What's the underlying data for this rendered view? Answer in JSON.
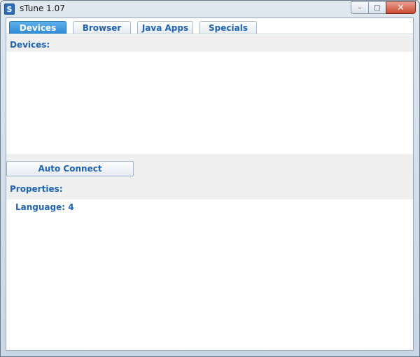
{
  "window": {
    "icon_letter": "S",
    "title": "sTune 1.07",
    "minimize": "–",
    "maximize": "□",
    "close": "✕"
  },
  "tabs": [
    {
      "label": "Devices",
      "active": true
    },
    {
      "label": "Browser",
      "active": false
    },
    {
      "label": "Java Apps",
      "active": false
    },
    {
      "label": "Specials",
      "active": false
    }
  ],
  "devices": {
    "header": "Devices:"
  },
  "actions": {
    "auto_connect": "Auto Connect"
  },
  "properties": {
    "header": "Properties:",
    "rows": [
      {
        "text": "Language: 4"
      }
    ]
  },
  "colors": {
    "accent": "#1f63b0",
    "active_tab": "#2e8ad6",
    "panel_gray": "#efefef"
  }
}
